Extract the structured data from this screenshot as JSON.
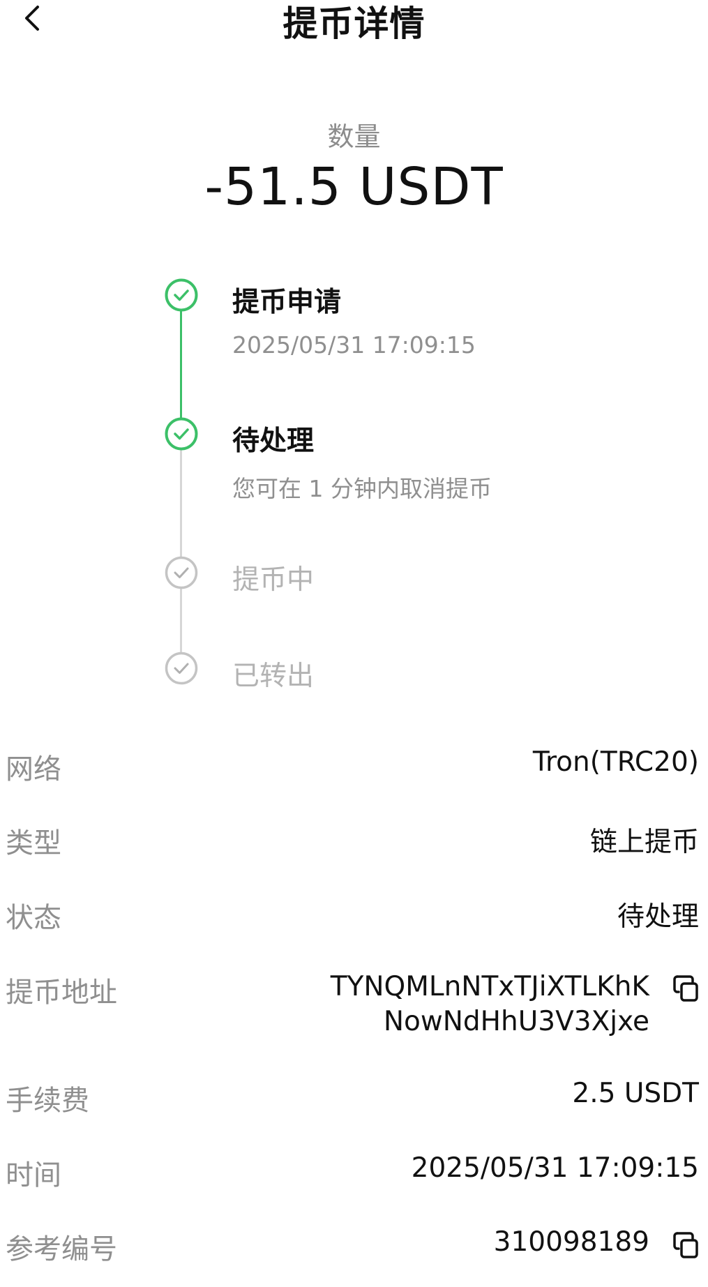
{
  "header": {
    "title": "提币详情",
    "back_icon": "chevron-left-icon"
  },
  "amount": {
    "label": "数量",
    "value": "-51.5 USDT"
  },
  "steps": [
    {
      "title": "提币申请",
      "subtitle": "2025/05/31 17:09:15",
      "status": "done"
    },
    {
      "title": "待处理",
      "subtitle": "您可在 1 分钟内取消提币",
      "status": "done"
    },
    {
      "title": "提币中",
      "subtitle": "",
      "status": "pending"
    },
    {
      "title": "已转出",
      "subtitle": "",
      "status": "pending"
    }
  ],
  "details": {
    "network": {
      "label": "网络",
      "value": "Tron(TRC20)"
    },
    "type": {
      "label": "类型",
      "value": "链上提币"
    },
    "status": {
      "label": "状态",
      "value": "待处理"
    },
    "address": {
      "label": "提币地址",
      "line1": "TYNQMLnNTxTJiXTLKhK",
      "line2": "NowNdHhU3V3Xjxe"
    },
    "fee": {
      "label": "手续费",
      "value": "2.5 USDT"
    },
    "time": {
      "label": "时间",
      "value": "2025/05/31 17:09:15"
    },
    "reference": {
      "label": "参考编号",
      "value": "310098189"
    }
  },
  "colors": {
    "accent_green": "#3cc068",
    "muted_gray": "#b3b3b3",
    "label_gray": "#8f8f8f"
  }
}
